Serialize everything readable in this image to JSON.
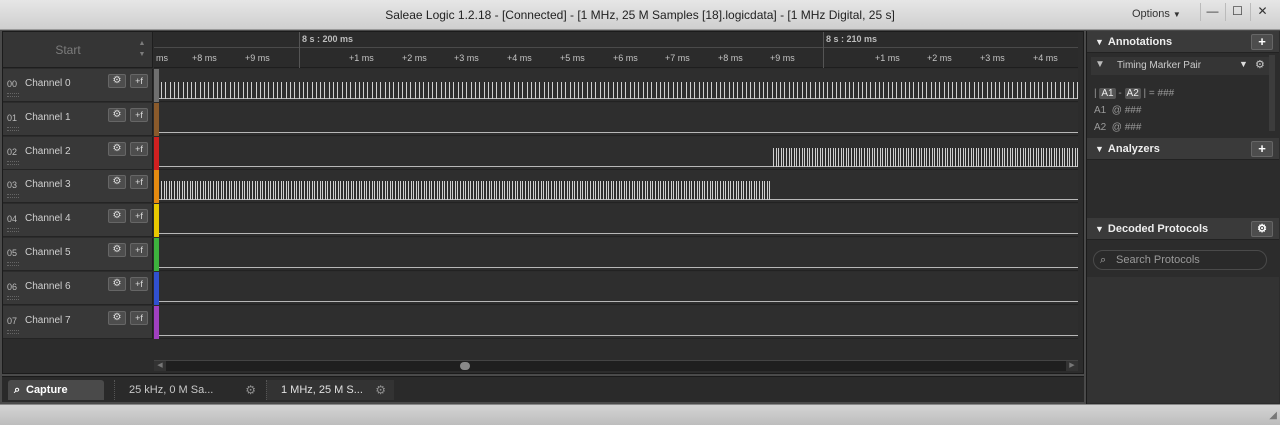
{
  "window": {
    "title": "Saleae Logic 1.2.18 - [Connected] - [1 MHz, 25 M Samples [18].logicdata] - [1 MHz Digital, 25 s]",
    "options_label": "Options",
    "minimize": "—",
    "maximize": "☐",
    "close": "✕"
  },
  "start": {
    "label": "Start",
    "spin_up": "▲",
    "spin_down": "▼"
  },
  "ruler": {
    "major": [
      "8 s : 200 ms",
      "8 s : 210 ms"
    ],
    "ticks": [
      "ms",
      "+8 ms",
      "+9 ms",
      "+1 ms",
      "+2 ms",
      "+3 ms",
      "+4 ms",
      "+5 ms",
      "+6 ms",
      "+7 ms",
      "+8 ms",
      "+9 ms",
      "+1 ms",
      "+2 ms",
      "+3 ms",
      "+4 ms"
    ]
  },
  "channels": [
    {
      "num": "00",
      "name": "Channel 0",
      "color": "#6f6f6f"
    },
    {
      "num": "01",
      "name": "Channel 1",
      "color": "#8a5a2b"
    },
    {
      "num": "02",
      "name": "Channel 2",
      "color": "#d02020"
    },
    {
      "num": "03",
      "name": "Channel 3",
      "color": "#e58a10"
    },
    {
      "num": "04",
      "name": "Channel 4",
      "color": "#e8c800"
    },
    {
      "num": "05",
      "name": "Channel 5",
      "color": "#3db33d"
    },
    {
      "num": "06",
      "name": "Channel 6",
      "color": "#3050d0"
    },
    {
      "num": "07",
      "name": "Channel 7",
      "color": "#a040c0"
    }
  ],
  "channel_icons": {
    "gear": "⚙",
    "trigger": "+f"
  },
  "tabs": {
    "capture": "Capture",
    "capture_icon": "search-icon",
    "session1": "25 kHz, 0 M Sa...",
    "session2": "1 MHz, 25 M S...",
    "gear": "⚙"
  },
  "panel": {
    "annotations": "Annotations",
    "add": "+",
    "marker_pair": "Timing Marker Pair",
    "meas_diff_a1": "A1",
    "meas_diff_a2": "A2",
    "meas_diff_sep": "-",
    "meas_diff_value": "= ###",
    "meas_a1_label": "A1",
    "meas_a1_value": "@ ###",
    "meas_a2_label": "A2",
    "meas_a2_value": "@ ###",
    "analyzers": "Analyzers",
    "decoded": "Decoded Protocols",
    "search_placeholder": "Search Protocols",
    "search_value": ""
  }
}
